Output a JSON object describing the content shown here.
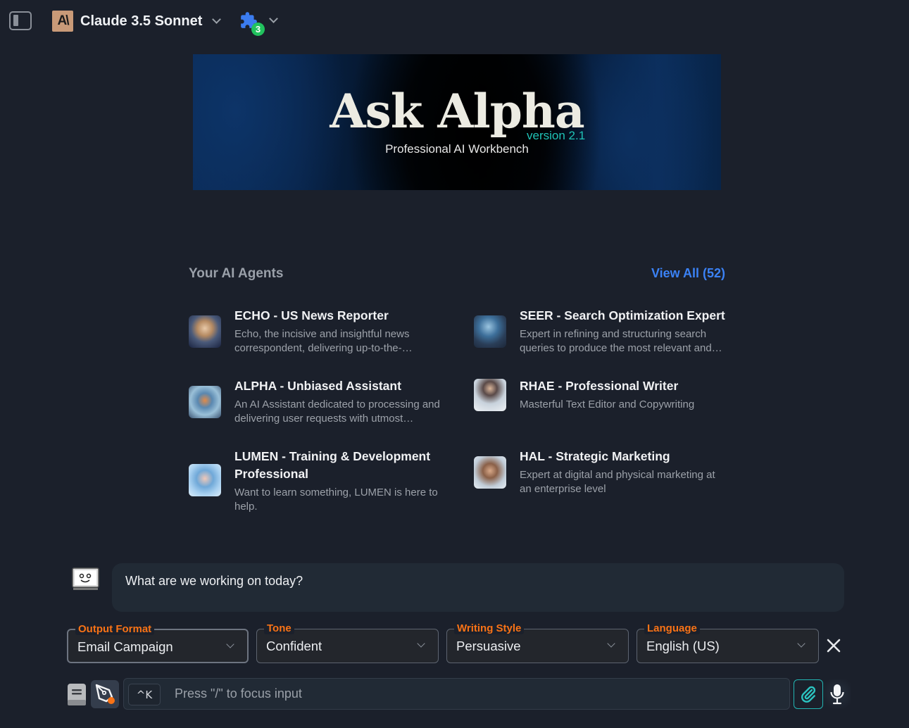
{
  "header": {
    "model_logo_text": "A\\",
    "model_name": "Claude 3.5 Sonnet",
    "plugins_count": "3",
    "icons": {
      "sidebar_toggle": "sidebar-toggle-icon",
      "model_dropdown": "chevron-down-icon",
      "plugins": "puzzle-icon",
      "plugins_dropdown": "chevron-down-icon"
    }
  },
  "banner": {
    "title": "Ask Alpha",
    "version": "version 2.1",
    "subtitle": "Professional AI Workbench"
  },
  "agents": {
    "title": "Your AI Agents",
    "view_all": "View All (52)",
    "items": [
      {
        "name": "ECHO - US News Reporter",
        "description": "Echo, the incisive and insightful news correspondent, delivering up-to-the-…"
      },
      {
        "name": "SEER - Search Optimization Expert",
        "description": "Expert in refining and structuring search queries to produce the most relevant and…"
      },
      {
        "name": "ALPHA - Unbiased Assistant",
        "description": "An AI Assistant dedicated to processing and delivering user requests with utmost…"
      },
      {
        "name": "RHAE - Professional Writer",
        "description": "Masterful Text Editor and Copywriting"
      },
      {
        "name": "LUMEN - Training & Development Professional",
        "description": "Want to learn something, LUMEN is here to help."
      },
      {
        "name": "HAL - Strategic Marketing",
        "description": "Expert at digital and physical marketing at an enterprise level"
      }
    ]
  },
  "chat": {
    "greeting": "What are we working on today?"
  },
  "options": {
    "output_format": {
      "label": "Output Format",
      "value": "Email Campaign"
    },
    "tone": {
      "label": "Tone",
      "value": "Confident"
    },
    "writing_style": {
      "label": "Writing Style",
      "value": "Persuasive"
    },
    "language": {
      "label": "Language",
      "value": "English (US)"
    }
  },
  "composer": {
    "shortcut": "^K",
    "placeholder": "Press \"/\" to focus input"
  },
  "colors": {
    "background": "#1b202b",
    "accent_orange": "#f97316",
    "link_blue": "#3b82f6",
    "teal": "#23b5b3",
    "badge_green": "#21c25e"
  }
}
